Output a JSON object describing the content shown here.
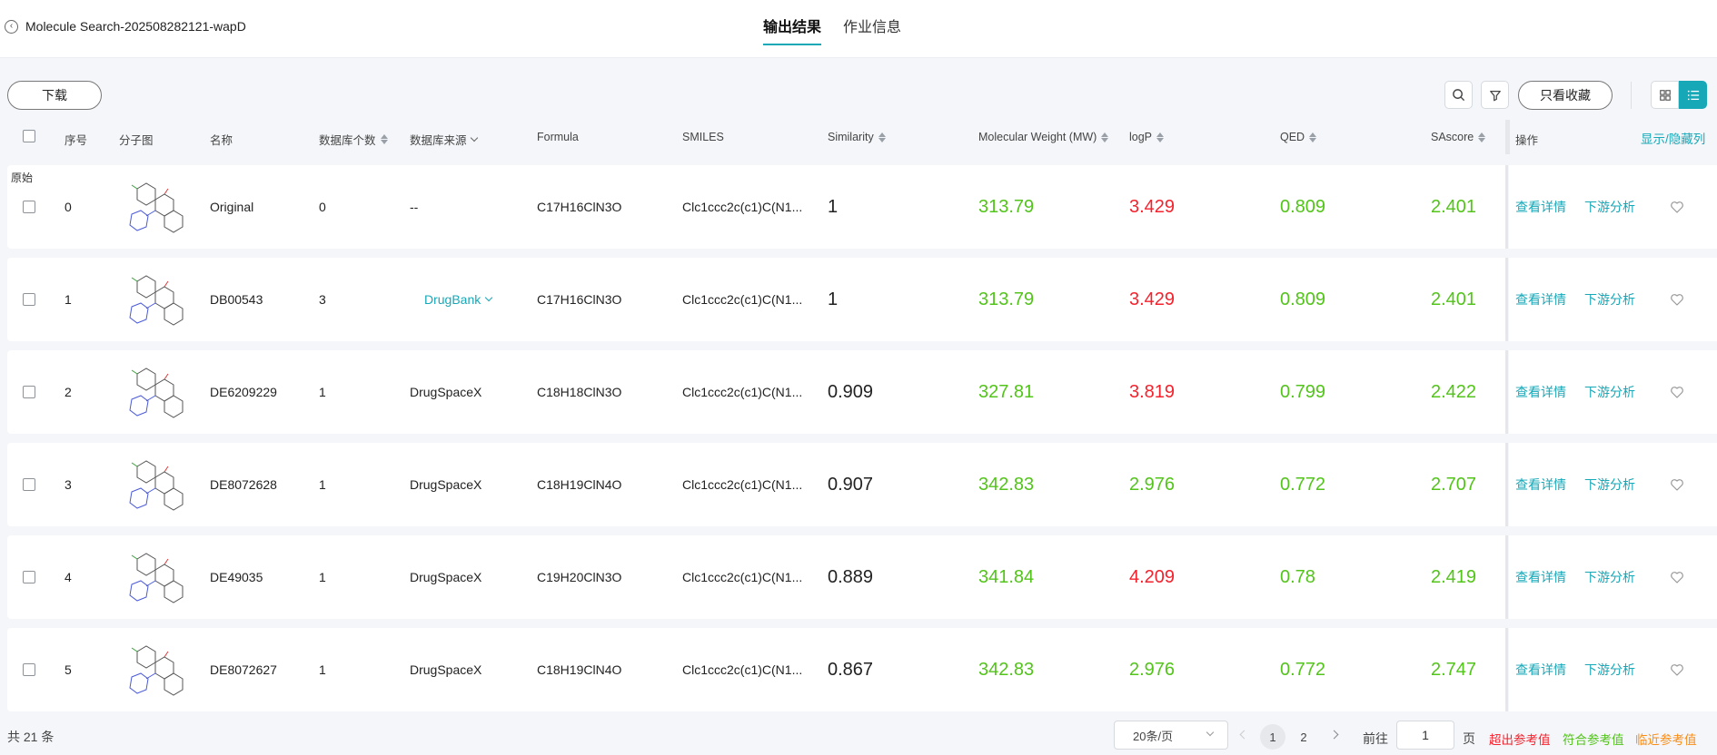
{
  "header": {
    "job_title": "Molecule Search-202508282121-wapD",
    "tabs": [
      {
        "label": "输出结果",
        "active": true
      },
      {
        "label": "作业信息",
        "active": false
      }
    ]
  },
  "toolbar": {
    "download_label": "下载",
    "favorites_only_label": "只看收藏",
    "icons": [
      "search-icon",
      "filter-icon",
      "grid-view-icon",
      "list-view-icon"
    ]
  },
  "table": {
    "headers": {
      "index": "序号",
      "structure": "分子图",
      "name": "名称",
      "db_count": "数据库个数",
      "db_source": "数据库来源",
      "formula": "Formula",
      "smiles": "SMILES",
      "similarity": "Similarity",
      "mw": "Molecular Weight (MW)",
      "logp": "logP",
      "qed": "QED",
      "sascore": "SAscore",
      "ops": "操作",
      "toggle_cols": "显示/隐藏列"
    },
    "original_tag": "原始",
    "actions": {
      "detail": "查看详情",
      "downstream": "下游分析"
    },
    "rows": [
      {
        "index": "0",
        "name": "Original",
        "db_count": "0",
        "db_source": "--",
        "db_link": false,
        "formula": "C17H16ClN3O",
        "smiles": "Clc1ccc2c(c1)C(N1...",
        "similarity": "1",
        "mw": "313.79",
        "logp": "3.429",
        "logp_status": "red",
        "qed": "0.809",
        "sascore": "2.401"
      },
      {
        "index": "1",
        "name": "DB00543",
        "db_count": "3",
        "db_source": "DrugBank",
        "db_link": true,
        "formula": "C17H16ClN3O",
        "smiles": "Clc1ccc2c(c1)C(N1...",
        "similarity": "1",
        "mw": "313.79",
        "logp": "3.429",
        "logp_status": "red",
        "qed": "0.809",
        "sascore": "2.401"
      },
      {
        "index": "2",
        "name": "DE6209229",
        "db_count": "1",
        "db_source": "DrugSpaceX",
        "db_link": false,
        "formula": "C18H18ClN3O",
        "smiles": "Clc1ccc2c(c1)C(N1...",
        "similarity": "0.909",
        "mw": "327.81",
        "logp": "3.819",
        "logp_status": "red",
        "qed": "0.799",
        "sascore": "2.422"
      },
      {
        "index": "3",
        "name": "DE8072628",
        "db_count": "1",
        "db_source": "DrugSpaceX",
        "db_link": false,
        "formula": "C18H19ClN4O",
        "smiles": "Clc1ccc2c(c1)C(N1...",
        "similarity": "0.907",
        "mw": "342.83",
        "logp": "2.976",
        "logp_status": "green",
        "qed": "0.772",
        "sascore": "2.707"
      },
      {
        "index": "4",
        "name": "DE49035",
        "db_count": "1",
        "db_source": "DrugSpaceX",
        "db_link": false,
        "formula": "C19H20ClN3O",
        "smiles": "Clc1ccc2c(c1)C(N1...",
        "similarity": "0.889",
        "mw": "341.84",
        "logp": "4.209",
        "logp_status": "red",
        "qed": "0.78",
        "sascore": "2.419"
      },
      {
        "index": "5",
        "name": "DE8072627",
        "db_count": "1",
        "db_source": "DrugSpaceX",
        "db_link": false,
        "formula": "C18H19ClN4O",
        "smiles": "Clc1ccc2c(c1)C(N1...",
        "similarity": "0.867",
        "mw": "342.83",
        "logp": "2.976",
        "logp_status": "green",
        "qed": "0.772",
        "sascore": "2.747"
      }
    ]
  },
  "footer": {
    "total": "共 21 条",
    "page_size": "20条/页",
    "pages": [
      "1",
      "2"
    ],
    "current_page": "1",
    "goto_label": "前往",
    "goto_value": "1",
    "page_unit": "页",
    "legend": [
      {
        "label": "超出参考值",
        "color": "#f5222d"
      },
      {
        "label": "符合参考值",
        "color": "#52c41a"
      },
      {
        "label": "临近参考值",
        "color": "#fa8c16"
      }
    ]
  },
  "colors": {
    "accent": "#17a8b8",
    "good": "#52c41a",
    "bad": "#f5222d",
    "near": "#fa8c16"
  }
}
